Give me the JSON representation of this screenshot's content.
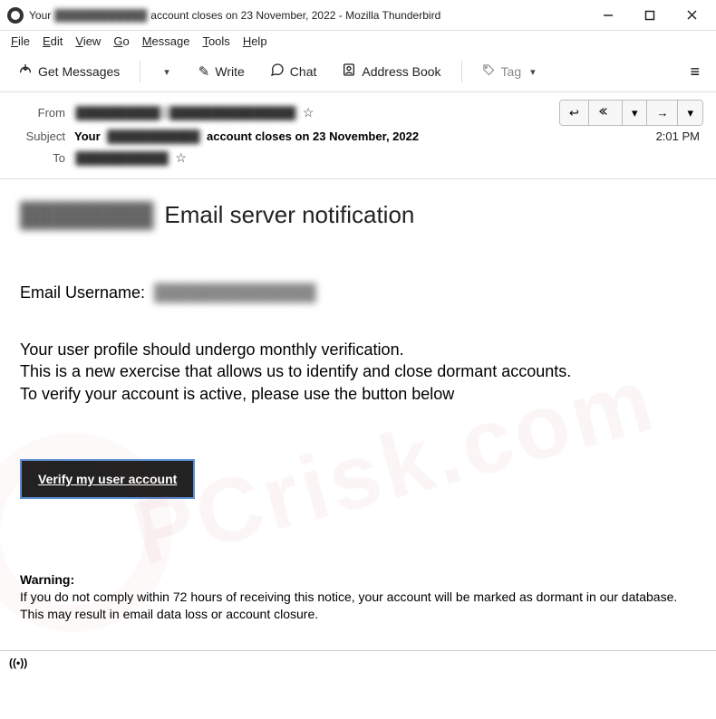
{
  "window": {
    "title_prefix": "Your",
    "title_redacted": "████████████",
    "title_suffix": "account closes on 23 November, 2022 - Mozilla Thunderbird"
  },
  "menubar": {
    "items": [
      {
        "u": "F",
        "rest": "ile"
      },
      {
        "u": "E",
        "rest": "dit"
      },
      {
        "u": "V",
        "rest": "iew"
      },
      {
        "u": "G",
        "rest": "o"
      },
      {
        "u": "M",
        "rest": "essage"
      },
      {
        "u": "T",
        "rest": "ools"
      },
      {
        "u": "H",
        "rest": "elp"
      }
    ]
  },
  "toolbar": {
    "get_messages": "Get Messages",
    "write": "Write",
    "chat": "Chat",
    "address_book": "Address Book",
    "tag": "Tag"
  },
  "headers": {
    "from_label": "From",
    "from_value_redacted": "██████████ · ███████████████",
    "subject_label": "Subject",
    "subject_prefix": "Your",
    "subject_redacted": "███████████",
    "subject_suffix": "account closes on 23 November, 2022",
    "time": "2:01 PM",
    "to_label": "To",
    "to_value_redacted": "███████████"
  },
  "email": {
    "heading_redacted": "████████",
    "heading_text": "Email server notification",
    "username_label": "Email Username:",
    "username_redacted": "██████████████",
    "line1": "Your user profile should undergo monthly verification.",
    "line2": "This is a new exercise that allows us to identify and close dormant accounts.",
    "line3": "To verify your account is active, please use the button below",
    "verify_button": "Verify my user account",
    "warning_title": "Warning:",
    "warning_line1": "If you do not comply within 72 hours of receiving this notice, your account will be marked as dormant in our database.",
    "warning_line2": "This may result in email data loss or account closure."
  },
  "status": {
    "icon": "((•))"
  }
}
